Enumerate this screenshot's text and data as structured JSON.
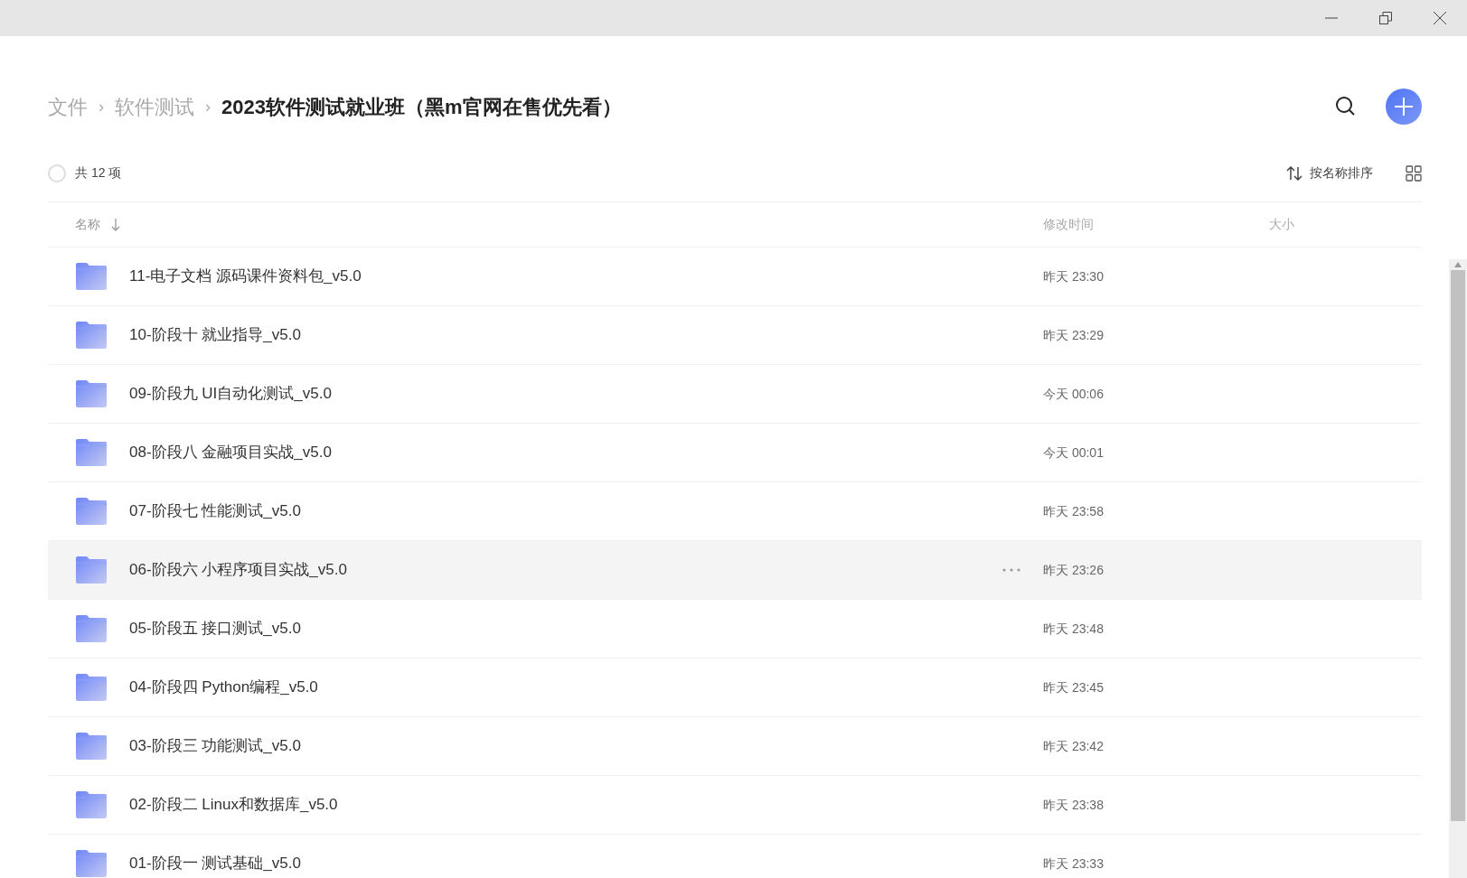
{
  "breadcrumb": [
    {
      "label": "文件",
      "current": false
    },
    {
      "label": "软件测试",
      "current": false
    },
    {
      "label": "2023软件测试就业班（黑m官网在售优先看）",
      "current": true
    }
  ],
  "breadcrumb_separator": "›",
  "select_all": {
    "checked": false,
    "label": "共 12 项"
  },
  "sort": {
    "label": "按名称排序"
  },
  "columns": [
    {
      "label": "名称",
      "sorted": true
    },
    {
      "label": "修改时间",
      "sorted": false
    },
    {
      "label": "大小",
      "sorted": false
    }
  ],
  "rows": [
    {
      "name": "11-电子文档 源码课件资料包_v5.0",
      "modified": "昨天 23:30",
      "hovered": false
    },
    {
      "name": "10-阶段十 就业指导_v5.0",
      "modified": "昨天 23:29",
      "hovered": false
    },
    {
      "name": "09-阶段九 UI自动化测试_v5.0",
      "modified": "今天 00:06",
      "hovered": false
    },
    {
      "name": "08-阶段八 金融项目实战_v5.0",
      "modified": "今天 00:01",
      "hovered": false
    },
    {
      "name": "07-阶段七 性能测试_v5.0",
      "modified": "昨天 23:58",
      "hovered": false
    },
    {
      "name": "06-阶段六 小程序项目实战_v5.0",
      "modified": "昨天 23:26",
      "hovered": true
    },
    {
      "name": "05-阶段五 接口测试_v5.0",
      "modified": "昨天 23:48",
      "hovered": false
    },
    {
      "name": "04-阶段四 Python编程_v5.0",
      "modified": "昨天 23:45",
      "hovered": false
    },
    {
      "name": "03-阶段三 功能测试_v5.0",
      "modified": "昨天 23:42",
      "hovered": false
    },
    {
      "name": "02-阶段二 Linux和数据库_v5.0",
      "modified": "昨天 23:38",
      "hovered": false
    },
    {
      "name": "01-阶段一 测试基础_v5.0",
      "modified": "昨天 23:33",
      "hovered": false
    }
  ]
}
